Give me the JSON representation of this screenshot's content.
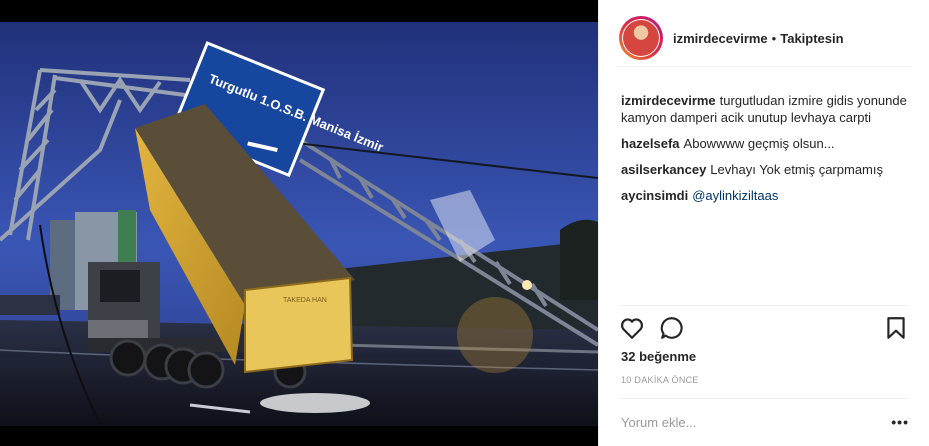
{
  "post": {
    "username": "izmirdecevirme",
    "follow_status": "Takiptesin",
    "sign_text": "Turgutlu 1.O.S.B. Manisa İzmir",
    "truck_text": "TAKEDA HAN",
    "caption": {
      "user": "izmirdecevirme",
      "text": "turgutludan izmire gidis yonunde kamyon damperi acik unutup levhaya carpti"
    },
    "comments": [
      {
        "user": "hazelsefa",
        "text": "Abowwww geçmiş olsun..."
      },
      {
        "user": "asilserkancey",
        "text": "Levhayı Yok etmiş çarpmamış"
      },
      {
        "user": "aycinsimdi",
        "text": "@aylinkiziltaas"
      }
    ],
    "likes": "32 beğenme",
    "time": "10 DAKİKA ÖNCE",
    "comment_placeholder": "Yorum ekle...",
    "more": "•••"
  },
  "colors": {
    "accent_link": "#003569",
    "meta_gray": "#999999",
    "text": "#262626"
  },
  "icons": [
    "heart-icon",
    "comment-icon",
    "bookmark-icon",
    "more-options-icon"
  ]
}
